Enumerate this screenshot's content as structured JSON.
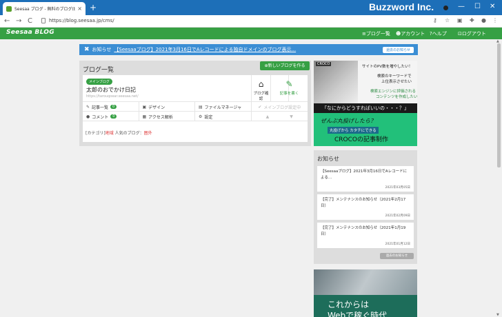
{
  "browser": {
    "tab_title": "Seesaa ブログ - 無料のブログ(blog)",
    "tab_close": "×",
    "new_tab": "+",
    "window_brand": "Buzzword Inc.",
    "minimize": "—",
    "maximize": "☐",
    "close": "✕",
    "back": "←",
    "forward": "→",
    "reload": "C",
    "url": "https://blog.seesaa.jp/cms/"
  },
  "site": {
    "logo": "Seesaa BLOG",
    "nav": {
      "blog_list": "≡ブログ一覧",
      "account": "アカウント",
      "help": "ヘルプ",
      "logout": "ログアウト"
    }
  },
  "notice": {
    "label": "お知らせ",
    "link": "【Seesaaブログ】2021年3月16日でAレコードによる独自ドメインのブログ表示...",
    "past_button": "過去のお知らせ"
  },
  "blog_list": {
    "heading": "ブログ一覧",
    "new_blog_button": "新しいブログを作る",
    "blog": {
      "badge": "メインブログ",
      "title": "太郎のおでかけ日記",
      "url": "https://tarouqoear.seesaa.net/",
      "check_blog": "ブログ確認",
      "write_post": "記事を書く"
    },
    "menu": [
      {
        "label": "記事一覧",
        "count": "0"
      },
      {
        "label": "デザイン"
      },
      {
        "label": "ファイルマネージャ"
      },
      {
        "label": "メインブログ設定中"
      },
      {
        "label": "コメント",
        "count": "0"
      },
      {
        "label": "アクセス解析"
      },
      {
        "label": "設定"
      }
    ],
    "category_prefix": "[カテゴリ]",
    "category_value": "地域",
    "popular_prefix": "人気のブログ：",
    "popular_value": "圏外"
  },
  "ad1": {
    "brand": "CROCO",
    "line1": "サイトのPV数を増やしたい！",
    "line2": "検索のキーワードで",
    "line3": "上位表示させたい",
    "line4": "検索エンジンに評価される",
    "line5": "コンテンツを作成したい",
    "banner": "「なにからどうすればいいの・・・？」",
    "bottom1": "ぜんぶ丸投げしたら？",
    "bottom2": "丸投げから カタチにできる",
    "bottom3": "CROCOの記事制作"
  },
  "news": {
    "heading": "お知らせ",
    "items": [
      {
        "title": "【Seesaaブログ】2021年3月16日でAレコードによる...",
        "date": "2021年03月05日"
      },
      {
        "title": "【完了】メンテナンスのお知らせ（2021年2月17日）",
        "date": "2021年02月09日"
      },
      {
        "title": "【完了】メンテナンスのお知らせ（2021年1月19日）",
        "date": "2021年01月12日"
      }
    ],
    "past_button": "過去のお知らせ"
  },
  "ad2": {
    "line1": "これからは",
    "line2": "Webで稼ぐ時代"
  }
}
